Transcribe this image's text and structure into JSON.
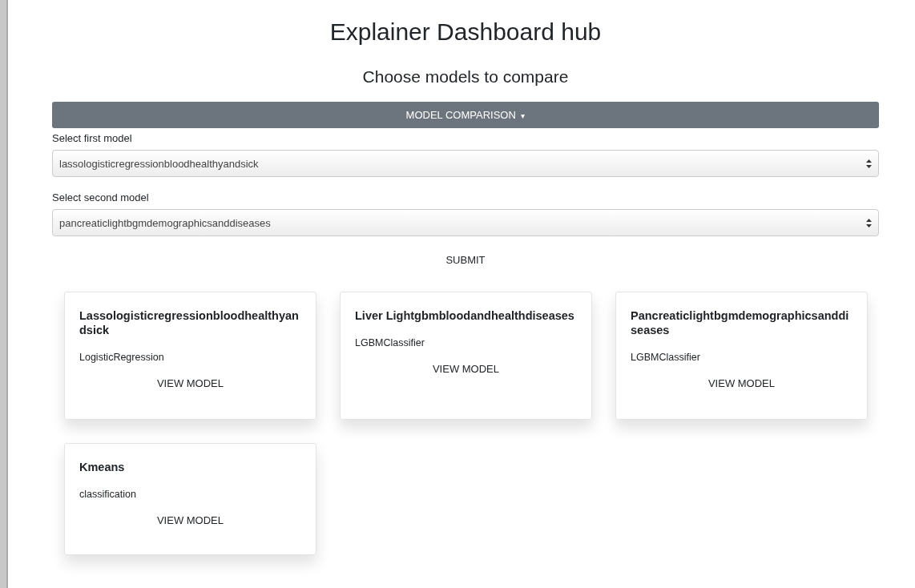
{
  "title": "Explainer Dashboard hub",
  "subtitle": "Choose models to compare",
  "comparison_bar": {
    "label": "MODEL COMPARISON",
    "caret": "▾"
  },
  "selects": [
    {
      "label": "Select first model",
      "value": "lassologisticregressionbloodhealthyandsick"
    },
    {
      "label": "Select second model",
      "value": "pancreaticlightbgmdemographicsanddiseases"
    }
  ],
  "submit": "SUBMIT",
  "cards": [
    {
      "title": "Lassologisticregressionbloodhealthyandsick",
      "subtitle": "LogisticRegression",
      "button": "VIEW MODEL"
    },
    {
      "title": "Liver Lightgbmbloodandhealthdiseases",
      "subtitle": "LGBMClassifier",
      "button": "VIEW MODEL"
    },
    {
      "title": "Pancreaticlightbgmdemographicsanddiseases",
      "subtitle": "LGBMClassifier",
      "button": "VIEW MODEL"
    },
    {
      "title": "Kmeans",
      "subtitle": "classification",
      "button": "VIEW MODEL"
    }
  ]
}
